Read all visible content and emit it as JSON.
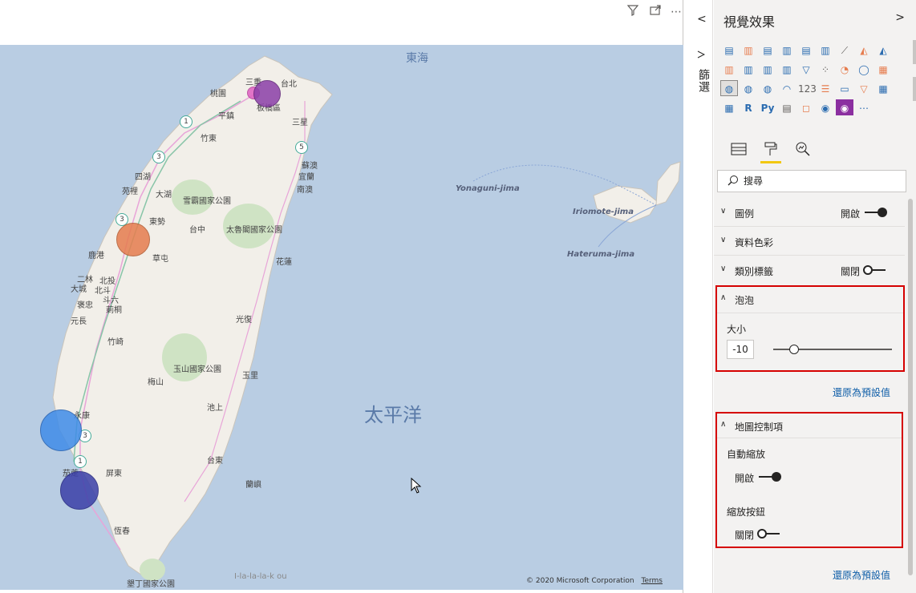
{
  "visual": {
    "header_icons": [
      "filter-icon",
      "focus-mode-icon",
      "more-options-icon"
    ],
    "more_glyph": "⋯",
    "map": {
      "ocean_east_sea": "東海",
      "ocean_pacific": "太平洋",
      "islands": [
        "Yonaguni-jima",
        "Iriomote-jima",
        "Hateruma-jima"
      ],
      "places": [
        "三重",
        "台北",
        "桃園",
        "板橋區",
        "平鎮",
        "竹東",
        "四湖",
        "苑裡",
        "大湖",
        "雪霸國家公園",
        "東勢",
        "台中",
        "太魯閣國家公園",
        "鹿港",
        "草屯",
        "北投",
        "花蓮",
        "二林",
        "大城",
        "斗六",
        "北斗",
        "莿桐",
        "褒忠",
        "元長",
        "光復",
        "竹崎",
        "梅山",
        "玉山國家公園",
        "玉里",
        "池上",
        "台東",
        "蘭嶼",
        "屏東",
        "永康",
        "茄萣",
        "恆春",
        "墾丁國家公園",
        "宜蘭",
        "蘇澳",
        "南澳",
        "三星"
      ],
      "highway_shields": [
        "1",
        "3",
        "5",
        "3",
        "3",
        "1"
      ],
      "copyright": "© 2020 Microsoft Corporation",
      "terms": "Terms",
      "bottom_label": "I-la-la-la-k ou"
    },
    "bubbles": [
      {
        "name": "bubble-taipei",
        "color": "#8b3fa8"
      },
      {
        "name": "bubble-taoyuan",
        "color": "#e05fc2"
      },
      {
        "name": "bubble-taichung",
        "color": "#e67d4f"
      },
      {
        "name": "bubble-tainan",
        "color": "#3f8ce8"
      },
      {
        "name": "bubble-kaohsiung",
        "color": "#3b3fa8"
      }
    ]
  },
  "filter_rail": {
    "collapse_glyph": "<",
    "label": "篩選"
  },
  "format_pane": {
    "title": "視覺效果",
    "next_glyph": ">",
    "viz_icons": [
      "stacked-bar-icon",
      "stacked-column-icon",
      "clustered-bar-icon",
      "clustered-column-icon",
      "100-bar-icon",
      "100-column-icon",
      "line-chart-icon",
      "area-chart-icon",
      "stacked-area-icon",
      "line-column-icon",
      "line-clustered-icon",
      "ribbon-chart-icon",
      "waterfall-icon",
      "funnel-icon",
      "scatter-icon",
      "pie-chart-icon",
      "donut-chart-icon",
      "treemap-icon",
      "map-icon",
      "filled-map-icon",
      "shape-map-icon",
      "gauge-icon",
      "card-icon",
      "multirow-card-icon",
      "kpi-icon",
      "slicer-icon",
      "table-icon",
      "matrix-icon",
      "r-visual-icon",
      "python-visual-icon",
      "key-influencers-icon",
      "qa-icon",
      "arcgis-icon",
      "custom-visual-icon",
      "more-visuals-icon"
    ],
    "viz_glyphs": [
      "▤",
      "▥",
      "▤",
      "▥",
      "▤",
      "▥",
      "⟋",
      "◭",
      "◭",
      "▥",
      "▥",
      "▥",
      "▥",
      "▽",
      "⁘",
      "◔",
      "◯",
      "▦",
      "◍",
      "◍",
      "◍",
      "◠",
      "123",
      "☰",
      "▭",
      "▽",
      "▦",
      "▦",
      "R",
      "Py",
      "▤",
      "◻",
      "◉",
      "◉",
      "⋯"
    ],
    "selected_viz": "map-icon",
    "tabs": {
      "fields": "fields-tab-icon",
      "format": "paint-roller-icon",
      "analytics": "analytics-tab-icon"
    },
    "tab_glyphs": {
      "fields": "▦",
      "format": "🖌",
      "analytics": "🔍"
    },
    "search": {
      "placeholder": "搜尋",
      "icon_glyph": "⌕"
    },
    "sections": {
      "legend": {
        "label": "圖例",
        "state": "開啟",
        "on": true
      },
      "data_colors": {
        "label": "資料色彩"
      },
      "category_labels": {
        "label": "類別標籤",
        "state": "關閉",
        "on": false
      },
      "bubbles": {
        "label": "泡泡",
        "size_label": "大小",
        "size_value": "-10",
        "size_level": 0.15,
        "reset": "還原為預設值"
      },
      "map_controls": {
        "label": "地圖控制項",
        "auto_zoom_label": "自動縮放",
        "auto_zoom_state": "開啟",
        "auto_zoom_on": true,
        "zoom_buttons_label": "縮放按鈕",
        "zoom_buttons_state": "關閉",
        "zoom_buttons_on": false,
        "reset": "還原為預設值"
      }
    },
    "caret_down": "∨",
    "caret_up": "∧",
    "highlight_color": "#d50000"
  }
}
